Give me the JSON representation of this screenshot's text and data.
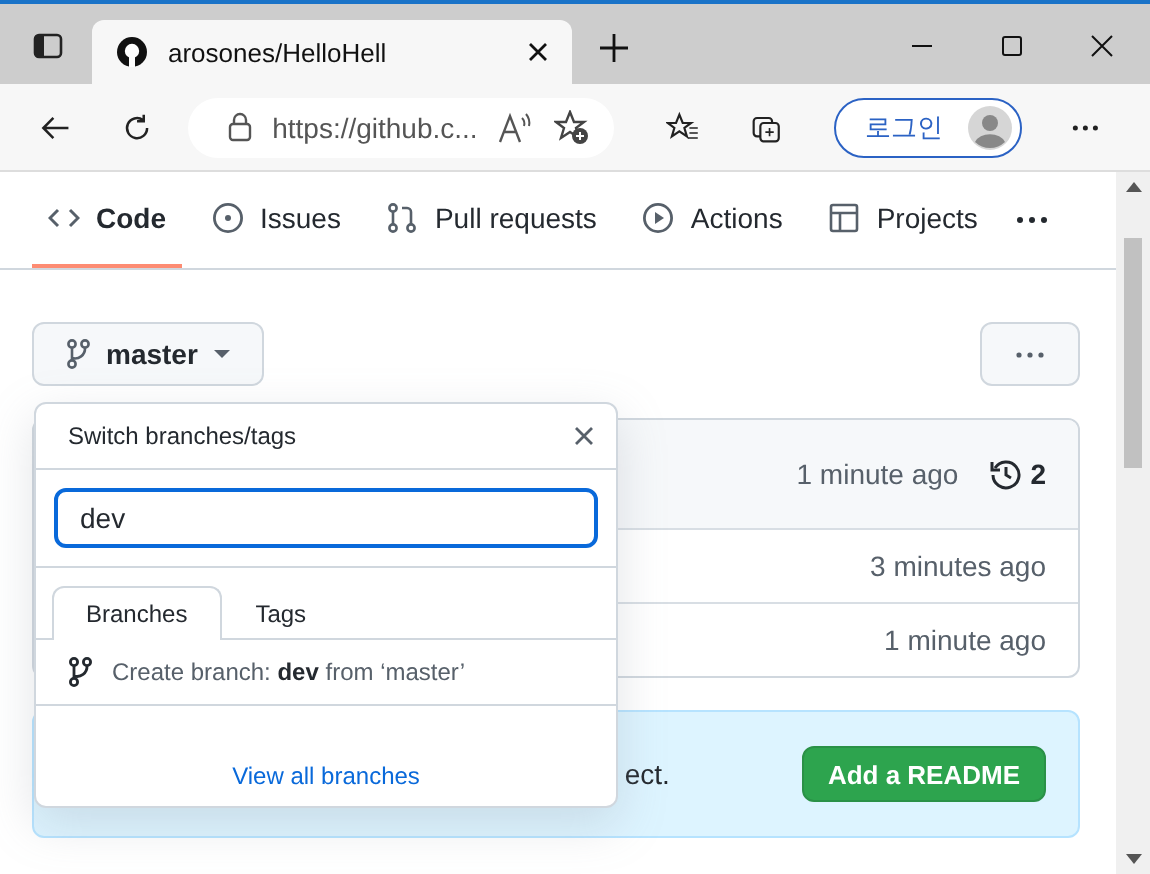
{
  "browser": {
    "tab": {
      "title": "arosones/HelloHell"
    },
    "address": "https://github.c...",
    "login_button": "로그인"
  },
  "repo_nav": [
    {
      "label": "Code",
      "selected": true,
      "kind": "code"
    },
    {
      "label": "Issues",
      "selected": false,
      "kind": "issue"
    },
    {
      "label": "Pull requests",
      "selected": false,
      "kind": "pr"
    },
    {
      "label": "Actions",
      "selected": false,
      "kind": "play"
    },
    {
      "label": "Projects",
      "selected": false,
      "kind": "table"
    }
  ],
  "branch_button": "master",
  "files": {
    "latest": "1 minute ago",
    "commits": "2",
    "rows": [
      {
        "time": "3 minutes ago"
      },
      {
        "time": "1 minute ago"
      }
    ]
  },
  "banner": {
    "text": "ect.",
    "button": "Add a README"
  },
  "dropdown": {
    "title": "Switch branches/tags",
    "search": {
      "value": "dev"
    },
    "tabs": [
      {
        "label": "Branches",
        "selected": true
      },
      {
        "label": "Tags",
        "selected": false
      }
    ],
    "create": "Create branch: **dev** from ‘master’",
    "footer_link": "View all branches"
  }
}
